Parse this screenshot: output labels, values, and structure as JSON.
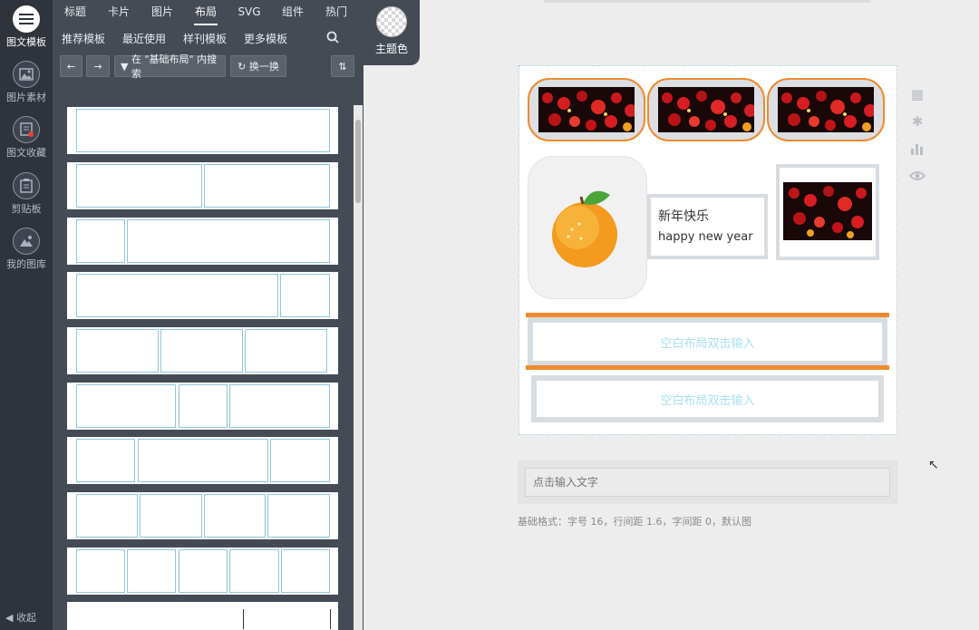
{
  "sidebar": {
    "items": [
      {
        "label": "图文模板",
        "icon": "menu-icon",
        "active": true
      },
      {
        "label": "图片素材",
        "icon": "image-icon",
        "active": false
      },
      {
        "label": "图文收藏",
        "icon": "favorite-icon",
        "active": false
      },
      {
        "label": "剪贴板",
        "icon": "clipboard-icon",
        "active": false
      },
      {
        "label": "我的图库",
        "icon": "gallery-icon",
        "active": false
      }
    ],
    "collapse_label": "收起"
  },
  "panel": {
    "tabs": [
      "标题",
      "卡片",
      "图片",
      "布局",
      "SVG",
      "组件",
      "热门"
    ],
    "active_tab": "布局",
    "subtabs": [
      "推荐模板",
      "最近使用",
      "样刊模板",
      "更多模板"
    ],
    "filter_label": "在 \"基础布局\" 内搜索",
    "swap_label": "换一换"
  },
  "theme": {
    "label": "主题色"
  },
  "editor": {
    "greeting_cn": "新年快乐",
    "greeting_en": "happy new year",
    "blank_placeholder_1": "空白布局双击输入",
    "blank_placeholder_2": "空白布局双击输入",
    "accent": "#f08a2e",
    "input_placeholder": "点击输入文字",
    "format_hint": "基础格式：字号 16，行间距 1.6，字间距 0，默认图"
  }
}
